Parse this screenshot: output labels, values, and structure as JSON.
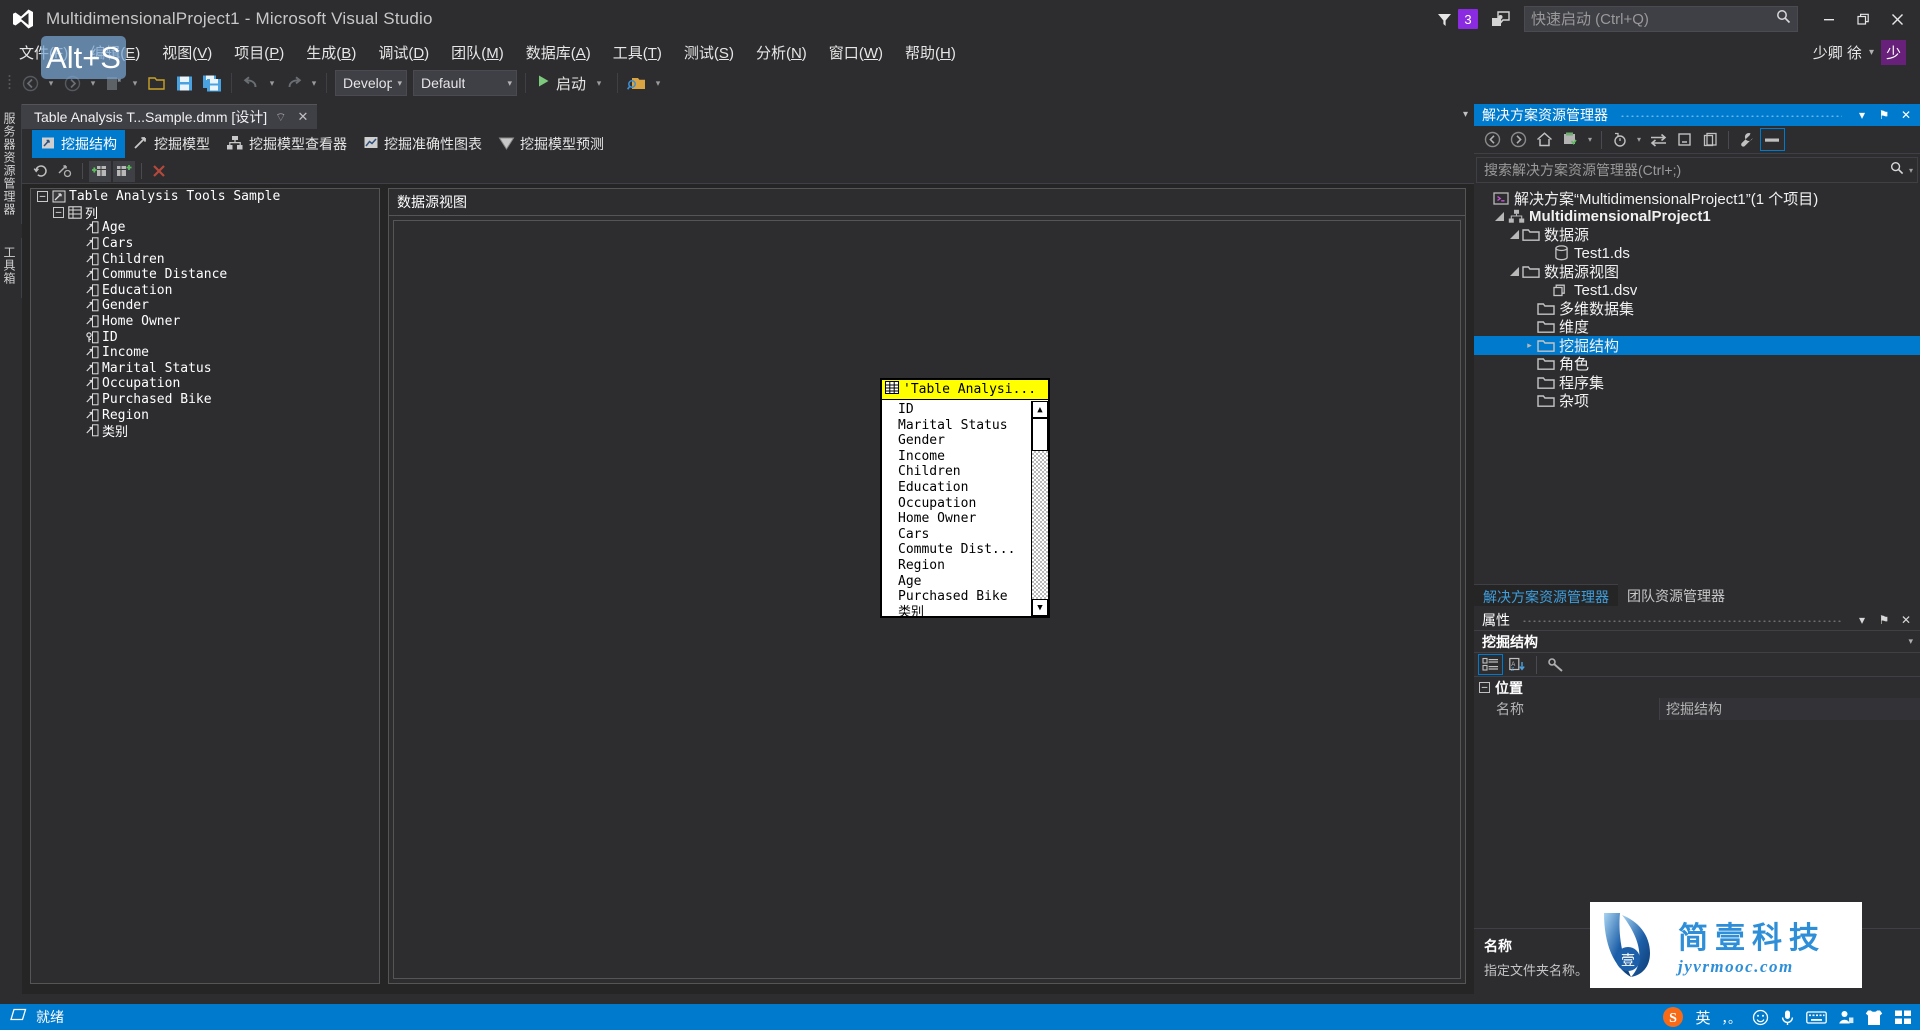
{
  "window": {
    "title": "MultidimensionalProject1 - Microsoft Visual Studio",
    "logo_icon": "visual-studio-logo",
    "minimize_label": "—",
    "restore_label": "❐",
    "close_label": "✕"
  },
  "title_right": {
    "filter_icon": "feedback-filter-icon",
    "notification_count": "3",
    "notification_color": "#8a2be2",
    "feedback_icon": "send-feedback-icon"
  },
  "quick_launch": {
    "placeholder": "快速启动 (Ctrl+Q)",
    "value": "",
    "search_icon": "search-icon"
  },
  "user": {
    "name": "少卿 徐",
    "avatar_initial": "少",
    "caret": "▾"
  },
  "menubar": {
    "items": [
      {
        "label": "文件",
        "accel": "F"
      },
      {
        "label": "编辑",
        "accel": "E"
      },
      {
        "label": "视图",
        "accel": "V"
      },
      {
        "label": "项目",
        "accel": "P"
      },
      {
        "label": "生成",
        "accel": "B"
      },
      {
        "label": "调试",
        "accel": "D"
      },
      {
        "label": "团队",
        "accel": "M"
      },
      {
        "label": "数据库",
        "accel": "A"
      },
      {
        "label": "工具",
        "accel": "T"
      },
      {
        "label": "测试",
        "accel": "S"
      },
      {
        "label": "分析",
        "accel": "N"
      },
      {
        "label": "窗口",
        "accel": "W"
      },
      {
        "label": "帮助",
        "accel": "H"
      }
    ]
  },
  "overlay_tooltip": {
    "text": "Alt+S"
  },
  "toolbar": {
    "back_icon": "navigate-back-icon",
    "forward_icon": "navigate-forward-icon",
    "new_project_icon": "new-project-icon",
    "open_icon": "open-file-icon",
    "save_icon": "save-icon",
    "save_all_icon": "save-all-icon",
    "undo_icon": "undo-icon",
    "redo_icon": "redo-icon",
    "config_combo": {
      "value": "Develop",
      "caret": "▾"
    },
    "platform_combo": {
      "value": "Default",
      "caret": "▾"
    },
    "start_label": "启动",
    "start_icon": "play-icon",
    "start_caret": "▾",
    "deploy_icon": "deploy-solution-icon",
    "overflow_caret": "▾"
  },
  "left_vtabs": {
    "items": [
      {
        "label": "服务器资源管理器"
      },
      {
        "label": "工具箱"
      }
    ]
  },
  "document": {
    "tab": {
      "title": "Table Analysis T...Sample.dmm [设计]",
      "pin_icon": "pin-icon",
      "close_icon": "close-icon"
    },
    "overflow_caret": "▾",
    "designer_tabs": [
      {
        "label": "挖掘结构",
        "icon": "mining-structure-icon",
        "active": true
      },
      {
        "label": "挖掘模型",
        "icon": "mining-model-icon",
        "active": false
      },
      {
        "label": "挖掘模型查看器",
        "icon": "mining-model-viewer-icon",
        "active": false
      },
      {
        "label": "挖掘准确性图表",
        "icon": "accuracy-chart-icon",
        "active": false
      },
      {
        "label": "挖掘模型预测",
        "icon": "prediction-icon",
        "active": false
      }
    ],
    "designer_toolbar": [
      {
        "icon": "refresh-icon",
        "framed": false
      },
      {
        "icon": "mining-structure-properties-icon",
        "framed": false
      },
      {
        "icon": "add-table-icon",
        "framed": true
      },
      {
        "icon": "add-related-table-icon",
        "framed": true
      },
      {
        "icon": "delete-icon",
        "framed": false
      }
    ]
  },
  "structure_tree": {
    "root": {
      "label": "Table Analysis Tools Sample",
      "icon": "mining-structure-icon",
      "expanded": true,
      "toggle": "–"
    },
    "columns_group": {
      "label": "列",
      "icon": "columns-folder-icon",
      "expanded": true,
      "toggle": "–"
    },
    "columns": [
      {
        "label": "Age",
        "icon": "column-icon"
      },
      {
        "label": "Cars",
        "icon": "column-icon"
      },
      {
        "label": "Children",
        "icon": "column-icon"
      },
      {
        "label": "Commute Distance",
        "icon": "column-icon"
      },
      {
        "label": "Education",
        "icon": "column-icon"
      },
      {
        "label": "Gender",
        "icon": "column-icon"
      },
      {
        "label": "Home Owner",
        "icon": "column-icon"
      },
      {
        "label": "ID",
        "icon": "key-column-icon"
      },
      {
        "label": "Income",
        "icon": "column-icon"
      },
      {
        "label": "Marital Status",
        "icon": "column-icon"
      },
      {
        "label": "Occupation",
        "icon": "column-icon"
      },
      {
        "label": "Purchased Bike",
        "icon": "column-icon"
      },
      {
        "label": "Region",
        "icon": "column-icon"
      },
      {
        "label": "类别",
        "icon": "column-icon"
      }
    ]
  },
  "dsv_pane": {
    "header": "数据源视图"
  },
  "table_box": {
    "title": "'Table Analysi...",
    "title_icon": "table-icon",
    "title_bg": "#ffff00",
    "items": [
      "ID",
      "Marital Status",
      "Gender",
      "Income",
      "Children",
      "Education",
      "Occupation",
      "Home Owner",
      "Cars",
      "Commute Dist...",
      "Region",
      "Age",
      "Purchased Bike",
      "类别"
    ],
    "scrollbar": {
      "up_arrow": "▲",
      "down_arrow": "▼"
    }
  },
  "solution_explorer": {
    "title": "解决方案资源管理器",
    "dropdown_icon": "▾",
    "pin_icon": "⚑",
    "close_icon": "✕",
    "toolbar": [
      {
        "icon": "navigate-back-icon",
        "selected": false
      },
      {
        "icon": "navigate-forward-icon",
        "selected": false
      },
      {
        "icon": "home-icon",
        "selected": false
      },
      {
        "icon": "pending-changes-icon",
        "selected": false
      },
      {
        "icon": "show-all-files-icon",
        "selected": false
      },
      {
        "icon": "sync-with-active-document-icon",
        "selected": false
      },
      {
        "icon": "collapse-all-icon",
        "selected": false
      },
      {
        "icon": "view-code-icon",
        "selected": false
      },
      {
        "icon": "properties-wrench-icon",
        "selected": false
      },
      {
        "icon": "preview-selected-items-icon",
        "selected": true
      }
    ],
    "search": {
      "placeholder": "搜索解决方案资源管理器(Ctrl+;)",
      "value": "",
      "search_icon": "search-icon",
      "caret": "▾"
    },
    "tree": [
      {
        "label": "解决方案“MultidimensionalProject1”(1 个项目)",
        "icon": "solution-icon",
        "indent": 0,
        "expander": "",
        "bold": false,
        "selected": false
      },
      {
        "label": "MultidimensionalProject1",
        "icon": "analysis-project-icon",
        "indent": 1,
        "expander": "◢",
        "bold": true,
        "selected": false
      },
      {
        "label": "数据源",
        "icon": "folder-icon",
        "indent": 2,
        "expander": "◢",
        "bold": false,
        "selected": false
      },
      {
        "label": "Test1.ds",
        "icon": "datasource-icon",
        "indent": 4,
        "expander": "",
        "bold": false,
        "selected": false
      },
      {
        "label": "数据源视图",
        "icon": "folder-icon",
        "indent": 2,
        "expander": "◢",
        "bold": false,
        "selected": false
      },
      {
        "label": "Test1.dsv",
        "icon": "dsv-icon",
        "indent": 4,
        "expander": "",
        "bold": false,
        "selected": false
      },
      {
        "label": "多维数据集",
        "icon": "folder-icon",
        "indent": 3,
        "expander": "",
        "bold": false,
        "selected": false
      },
      {
        "label": "维度",
        "icon": "folder-icon",
        "indent": 3,
        "expander": "",
        "bold": false,
        "selected": false
      },
      {
        "label": "挖掘结构",
        "icon": "folder-icon",
        "indent": 3,
        "expander": "▸",
        "bold": false,
        "selected": true
      },
      {
        "label": "角色",
        "icon": "folder-icon",
        "indent": 3,
        "expander": "",
        "bold": false,
        "selected": false
      },
      {
        "label": "程序集",
        "icon": "folder-icon",
        "indent": 3,
        "expander": "",
        "bold": false,
        "selected": false
      },
      {
        "label": "杂项",
        "icon": "folder-icon",
        "indent": 3,
        "expander": "",
        "bold": false,
        "selected": false
      }
    ],
    "bottom_tabs": [
      {
        "label": "解决方案资源管理器",
        "active": true
      },
      {
        "label": "团队资源管理器",
        "active": false
      }
    ]
  },
  "properties": {
    "title": "属性",
    "dropdown_icon": "▾",
    "pin_icon": "⚑",
    "close_icon": "✕",
    "object_name": "挖掘结构",
    "object_caret": "▾",
    "toolbar": [
      {
        "icon": "categorized-view-icon",
        "selected": true
      },
      {
        "icon": "alphabetical-view-icon",
        "selected": false
      },
      {
        "icon": "property-pages-icon",
        "selected": false
      }
    ],
    "category": {
      "label": "位置",
      "toggle": "–"
    },
    "rows": [
      {
        "key": "名称",
        "value": "挖掘结构"
      }
    ],
    "description": {
      "heading": "名称",
      "text": "指定文件夹名称。"
    }
  },
  "statusbar": {
    "ready_icon": "ready-icon",
    "text": "就绪"
  },
  "ime_tray": {
    "items": [
      {
        "icon": "sogou-logo-icon",
        "label": "S"
      },
      {
        "icon": "language-mode-icon",
        "label": "英"
      },
      {
        "icon": "punctuation-icon",
        "label": "，。"
      },
      {
        "icon": "emoji-icon",
        "label": "☺"
      },
      {
        "icon": "voice-input-icon",
        "label": "🎤"
      },
      {
        "icon": "soft-keyboard-icon",
        "label": "⌨"
      },
      {
        "icon": "user-account-icon",
        "label": "👤"
      },
      {
        "icon": "skin-icon",
        "label": "👕"
      },
      {
        "icon": "toolbox-grid-icon",
        "label": "▦"
      }
    ]
  },
  "watermark": {
    "cn_text": "简壹科技",
    "en_text": "jyvrmooc.com",
    "logo_icon": "jianyi-logo-icon"
  }
}
